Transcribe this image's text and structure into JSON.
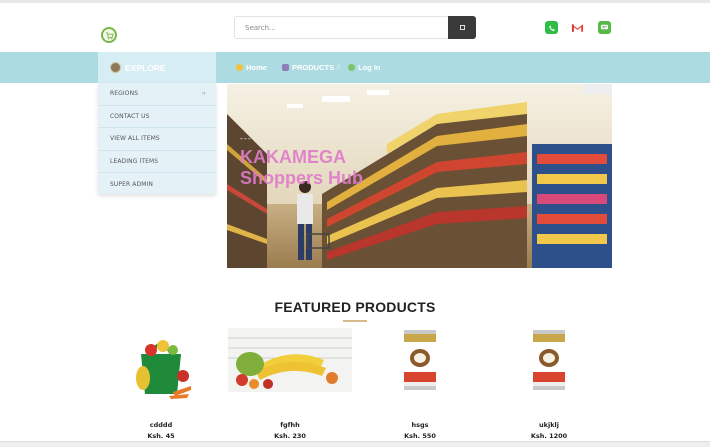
{
  "header": {
    "search": {
      "placeholder": "Search..."
    },
    "icons": [
      "phone-icon",
      "gmail-icon",
      "chat-icon"
    ]
  },
  "nav": {
    "explore_label": "EXPLORE",
    "items": [
      {
        "label": "Home",
        "icon": "home-icon"
      },
      {
        "label": "PRODUCTS",
        "icon": "products-icon"
      },
      {
        "label": "Log In",
        "icon": "login-icon"
      }
    ]
  },
  "sidebar": {
    "items": [
      {
        "label": "REGIONS",
        "has_submenu": true
      },
      {
        "label": "CONTACT US"
      },
      {
        "label": "VIEW ALL ITEMS"
      },
      {
        "label": "LEADING ITEMS"
      },
      {
        "label": "SUPER ADMIN"
      }
    ]
  },
  "hero": {
    "dash": "----",
    "title_line1": "KAKAMEGA",
    "title_line2": "Shoppers Hub"
  },
  "featured": {
    "title": "FEATURED PRODUCTS",
    "products": [
      {
        "name": "cdddd",
        "price": "Ksh. 45"
      },
      {
        "name": "fgfhh",
        "price": "Ksh. 230"
      },
      {
        "name": "hsgs",
        "price": "Ksh. 550"
      },
      {
        "name": "ukjklj",
        "price": "Ksh. 1200"
      }
    ]
  },
  "colors": {
    "navbar": "#acdbe2",
    "sidebar": "#e4f2f7",
    "hero_title": "#e07bc9",
    "accent_underline": "#d9b98a"
  }
}
